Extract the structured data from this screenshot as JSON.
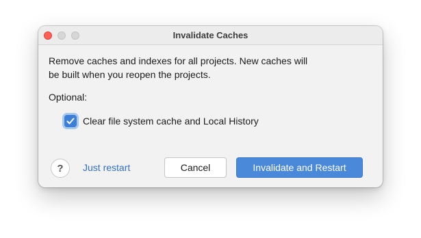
{
  "window": {
    "title": "Invalidate Caches"
  },
  "dialog": {
    "message_line1": "Remove caches and indexes for all projects. New caches will",
    "message_line2": "be built when you reopen the projects.",
    "optional_label": "Optional:",
    "checkbox": {
      "label": "Clear file system cache and Local History",
      "checked": true
    },
    "help_glyph": "?",
    "link_label": "Just restart",
    "cancel_label": "Cancel",
    "primary_label": "Invalidate and Restart"
  },
  "colors": {
    "accent": "#4a89d9",
    "link": "#2f6fc4",
    "close_button": "#fe5f57"
  }
}
